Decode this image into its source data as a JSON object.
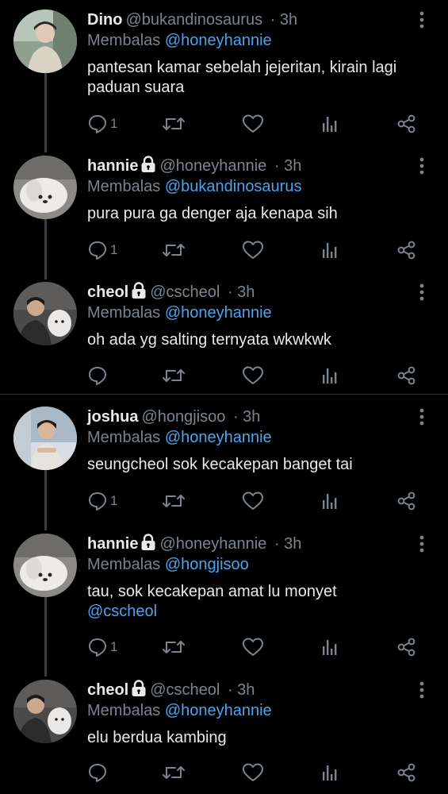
{
  "reply_prefix": "Membalas",
  "tweets": [
    {
      "name": "Dino",
      "protected": false,
      "handle": "@bukandinosaurus",
      "time": "· 3h",
      "reply_to": "@honeyhannie",
      "text": "pantesan kamar sebelah jejeritan, kirain lagi paduan suara",
      "mention": "",
      "reply_count": "1"
    },
    {
      "name": "hannie",
      "protected": true,
      "handle": "@honeyhannie",
      "time": "· 3h",
      "reply_to": "@bukandinosaurus",
      "text": "pura pura ga denger aja kenapa sih",
      "mention": "",
      "reply_count": "1"
    },
    {
      "name": "cheol",
      "protected": true,
      "handle": "@cscheol",
      "time": "· 3h",
      "reply_to": "@honeyhannie",
      "text": "oh ada yg salting ternyata wkwkwk",
      "mention": "",
      "reply_count": ""
    },
    {
      "name": "joshua",
      "protected": false,
      "handle": "@hongjisoo",
      "time": "· 3h",
      "reply_to": "@honeyhannie",
      "text": "seungcheol sok kecakepan banget tai",
      "mention": "",
      "reply_count": "1"
    },
    {
      "name": "hannie",
      "protected": true,
      "handle": "@honeyhannie",
      "time": "· 3h",
      "reply_to": "@hongjisoo",
      "text": "tau, sok kecakepan amat lu monyet",
      "mention": "@cscheol",
      "reply_count": "1"
    },
    {
      "name": "cheol",
      "protected": true,
      "handle": "@cscheol",
      "time": "· 3h",
      "reply_to": "@honeyhannie",
      "text": "elu berdua kambing",
      "mention": "",
      "reply_count": ""
    }
  ],
  "icons": {
    "reply": "reply-icon",
    "retweet": "retweet-icon",
    "like": "like-icon",
    "stats": "stats-icon",
    "share": "share-icon",
    "lock": "lock-icon",
    "more": "more-icon"
  },
  "colors": {
    "background": "#000000",
    "text": "#e7e9ea",
    "muted": "#7b848c",
    "link": "#4ea3ec",
    "thread_line": "#3a3f44",
    "separator": "#2f3336"
  }
}
